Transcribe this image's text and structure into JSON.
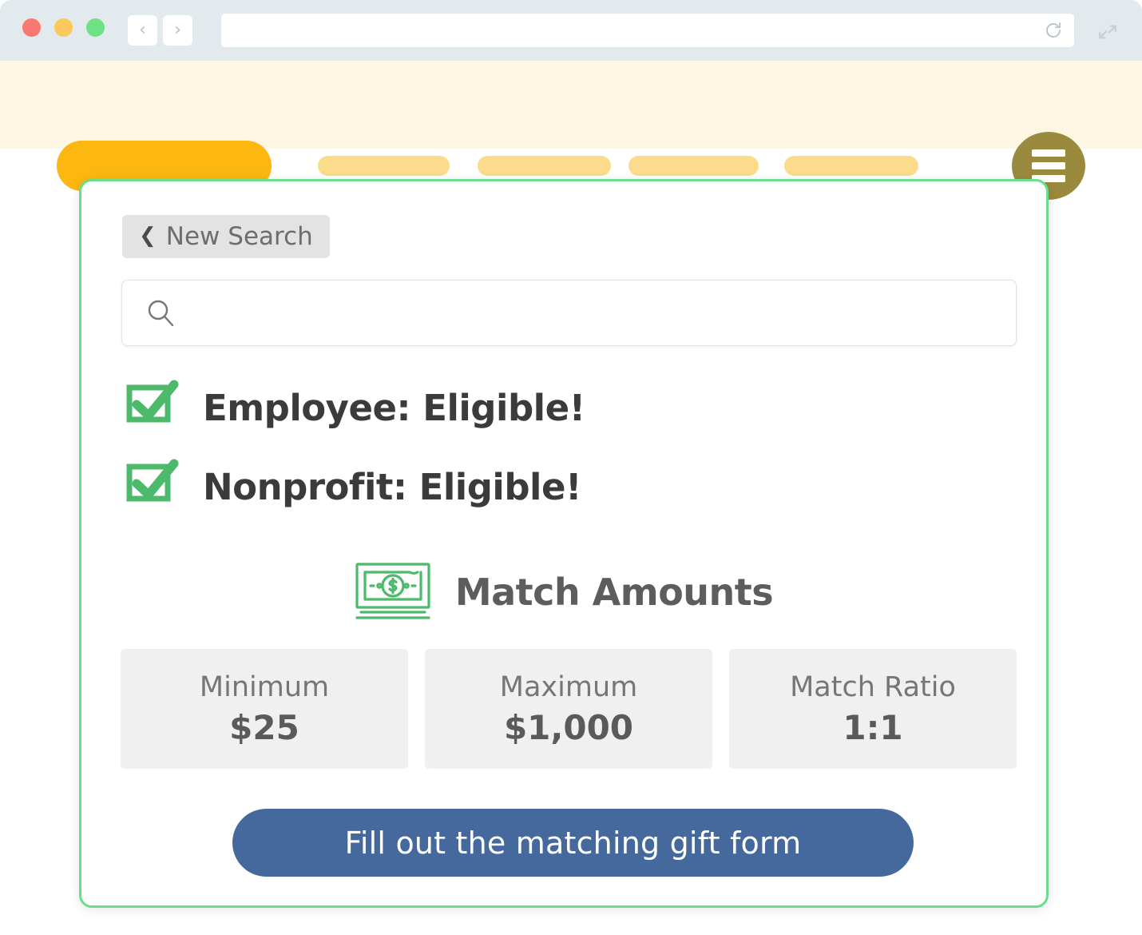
{
  "browser": {
    "window_controls": [
      "close",
      "minimize",
      "maximize"
    ],
    "back_label": "‹",
    "forward_label": "›",
    "url_value": "",
    "url_placeholder": "",
    "reload_icon": "reload-icon",
    "expand_icon": "expand-icon"
  },
  "site_nav": {
    "logo_placeholder": "",
    "menu_placeholders": [
      "",
      "",
      "",
      ""
    ],
    "hamburger_icon": "hamburger-icon"
  },
  "card": {
    "new_search": {
      "chevron": "❮",
      "label": "New Search"
    },
    "search": {
      "icon": "search-icon",
      "value": "",
      "placeholder": ""
    },
    "eligibility": [
      {
        "icon": "checkbox-checked-icon",
        "label": "Employee: Eligible!"
      },
      {
        "icon": "checkbox-checked-icon",
        "label": "Nonprofit: Eligible!"
      }
    ],
    "match_amounts": {
      "icon": "money-bill-icon",
      "heading": "Match Amounts",
      "stats": [
        {
          "label": "Minimum",
          "value": "$25"
        },
        {
          "label": "Maximum",
          "value": "$1,000"
        },
        {
          "label": "Match Ratio",
          "value": "1:1"
        }
      ]
    },
    "cta_label": "Fill out the matching gift form"
  },
  "colors": {
    "chrome_bg": "#e3eaee",
    "nav_bg": "#fdf6e3",
    "logo_orange": "#fcb711",
    "nav_pill": "#fcdc8c",
    "hamburger": "#9a8a3d",
    "card_border_green": "#6ade8c",
    "check_green": "#4cb96b",
    "money_green": "#4cb96b",
    "stat_bg": "#f0f0f0",
    "cta_blue": "#45699d",
    "heading_gray": "#3b3b3b"
  }
}
